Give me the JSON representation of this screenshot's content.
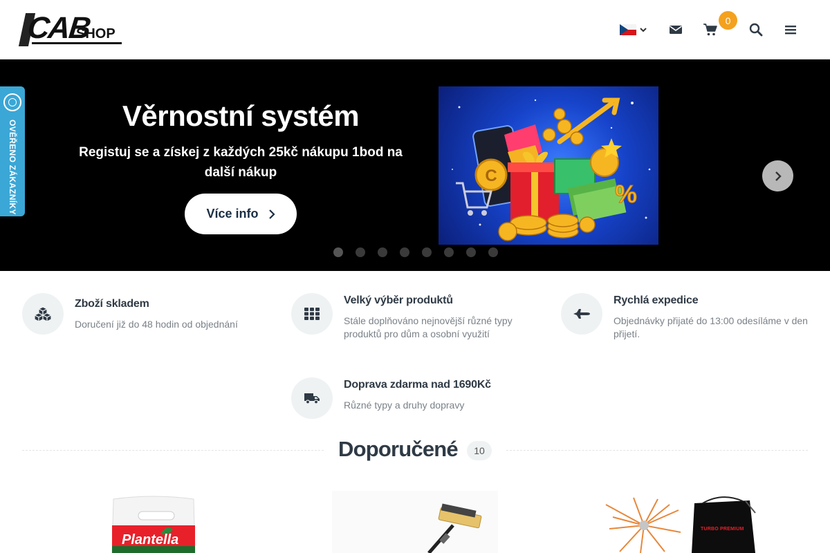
{
  "header": {
    "logo": {
      "cab": "CAB",
      "shop": "SHOP"
    },
    "language": "cs",
    "cart_count": "0",
    "icons": [
      "envelope-icon",
      "cart-icon",
      "search-icon",
      "menu-icon"
    ]
  },
  "hero": {
    "title": "Věrnostní systém",
    "subtitle": "Registuj se a získej z každých 25kč nákupu 1bod na další nákup",
    "button_label": "Více info",
    "slide_count": 8,
    "active_slide": 1
  },
  "side_badge": {
    "label": "OVĚŘENO ZÁKAZNÍKY"
  },
  "features": [
    {
      "title": "Zboží skladem",
      "desc": "Doručení již do 48 hodin od objednání",
      "icon": "boxes-icon"
    },
    {
      "title": "Velký výběr produktů",
      "desc": "Stále doplňováno nejnovější různé typy produktů pro dům a osobní využití",
      "icon": "grid-icon"
    },
    {
      "title": "Rychlá expedice",
      "desc": "Objednávky přijaté do 13:00 odesíláme v den přijetí.",
      "icon": "plane-icon"
    },
    {
      "title": "Doprava zdarma nad 1690Kč",
      "desc": "Různé typy a druhy dopravy",
      "icon": "truck-icon"
    }
  ],
  "recommended": {
    "title": "Doporučené",
    "count": "10"
  },
  "products": [
    {
      "brand_text": "Plantella"
    },
    {
      "brand_text": ""
    },
    {
      "brand_text": "TURBO PREMIUM"
    }
  ],
  "colors": {
    "accent": "#f4a11f",
    "hero_bg": "#000000",
    "badge": "#3aa7d6",
    "icon_bg": "#eef2f3"
  }
}
